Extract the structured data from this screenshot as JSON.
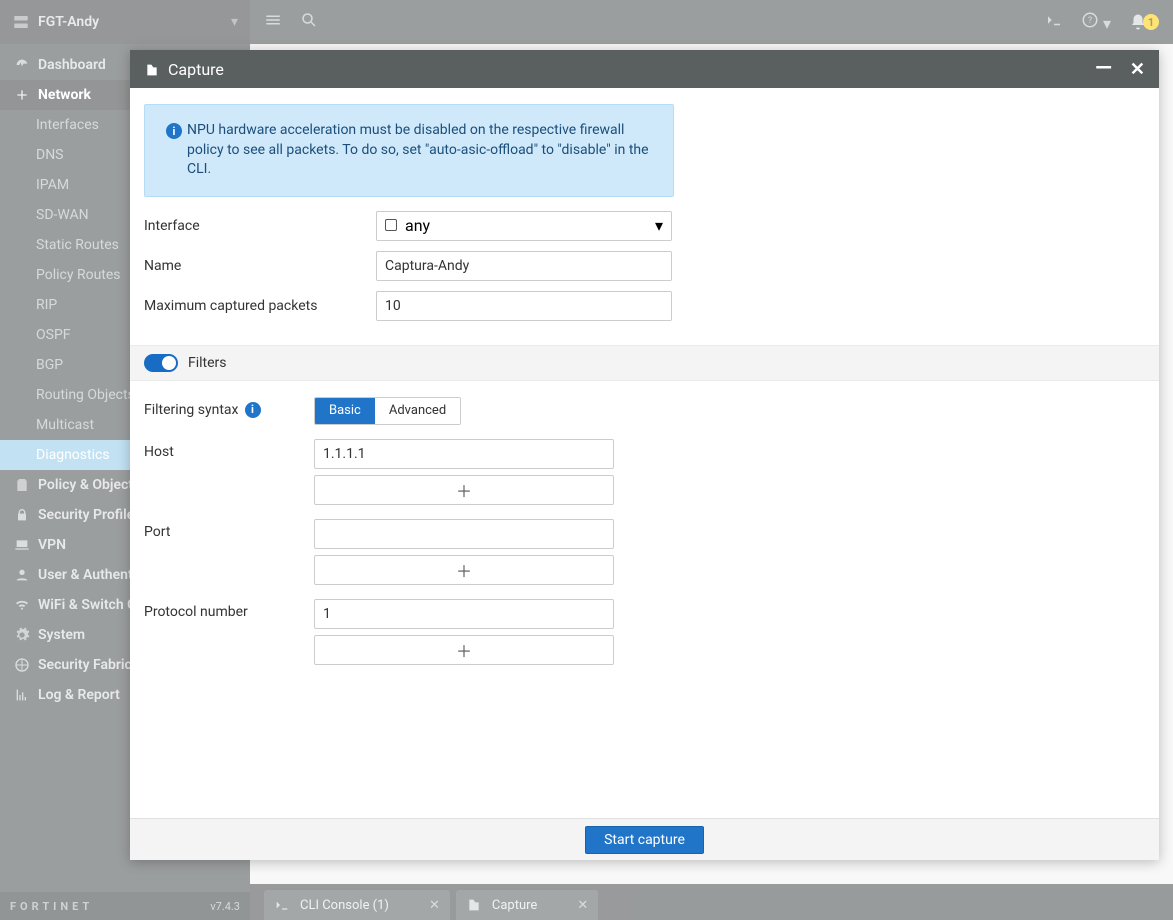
{
  "device": {
    "name": "FGT-Andy",
    "version": "v7.4.3",
    "brand": "FORTINET"
  },
  "topbar": {
    "notification_count": "1"
  },
  "sidebar": {
    "items": [
      {
        "label": "Dashboard",
        "icon": "gauge"
      },
      {
        "label": "Network",
        "icon": "plus-square",
        "active": true,
        "children": [
          {
            "label": "Interfaces"
          },
          {
            "label": "DNS"
          },
          {
            "label": "IPAM"
          },
          {
            "label": "SD-WAN"
          },
          {
            "label": "Static Routes"
          },
          {
            "label": "Policy Routes"
          },
          {
            "label": "RIP"
          },
          {
            "label": "OSPF"
          },
          {
            "label": "BGP"
          },
          {
            "label": "Routing Objects"
          },
          {
            "label": "Multicast"
          },
          {
            "label": "Diagnostics",
            "active": true
          }
        ]
      },
      {
        "label": "Policy & Objects",
        "icon": "clipboard"
      },
      {
        "label": "Security Profiles",
        "icon": "lock"
      },
      {
        "label": "VPN",
        "icon": "laptop"
      },
      {
        "label": "User & Authentication",
        "icon": "user"
      },
      {
        "label": "WiFi & Switch Controller",
        "icon": "wifi"
      },
      {
        "label": "System",
        "icon": "gear"
      },
      {
        "label": "Security Fabric",
        "icon": "fabric"
      },
      {
        "label": "Log & Report",
        "icon": "chart"
      }
    ]
  },
  "tabs": [
    {
      "label": "CLI Console (1)",
      "icon": "terminal"
    },
    {
      "label": "Capture",
      "icon": "capture"
    }
  ],
  "panel": {
    "title": "Capture",
    "info": "NPU hardware acceleration must be disabled on the respective firewall policy to see all packets. To do so, set \"auto-asic-offload\" to \"disable\" in the CLI.",
    "form": {
      "interface_label": "Interface",
      "interface_value": "any",
      "name_label": "Name",
      "name_value": "Captura-Andy",
      "max_label": "Maximum captured packets",
      "max_value": "10"
    },
    "filters": {
      "heading": "Filters",
      "syntax_label": "Filtering syntax",
      "syntax_options": {
        "basic": "Basic",
        "advanced": "Advanced"
      },
      "host_label": "Host",
      "host_value": "1.1.1.1",
      "port_label": "Port",
      "port_value": "",
      "protocol_label": "Protocol number",
      "protocol_value": "1"
    },
    "start_button": "Start capture"
  }
}
